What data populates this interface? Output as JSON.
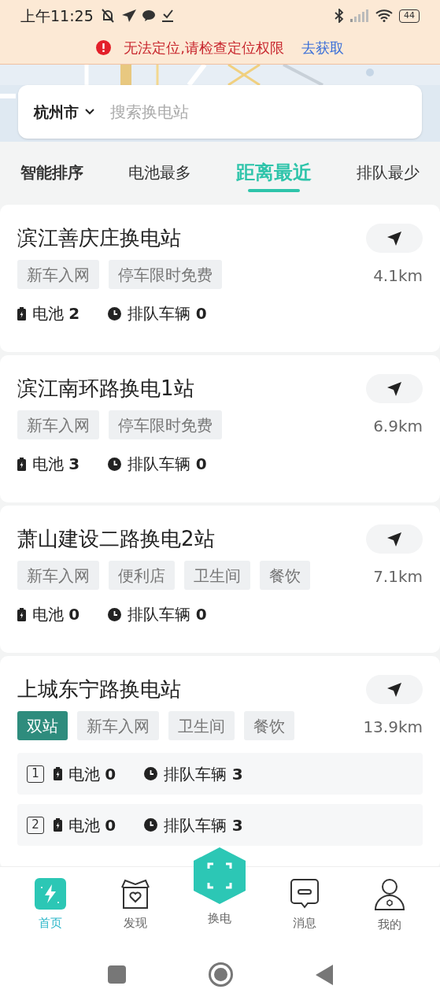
{
  "status_bar": {
    "time": "上午11:25",
    "battery": "44"
  },
  "banner": {
    "message": "无法定位,请检查定位权限",
    "action": "去获取"
  },
  "search": {
    "city": "杭州市",
    "placeholder": "搜索换电站"
  },
  "sort_tabs": [
    {
      "label": "智能排序",
      "selected": false
    },
    {
      "label": "电池最多",
      "selected": false
    },
    {
      "label": "距离最近",
      "selected": true
    },
    {
      "label": "排队最少",
      "selected": false
    }
  ],
  "stations": [
    {
      "name": "滨江善庆庄换电站",
      "distance": "4.1km",
      "kind": "single",
      "tags": [
        {
          "label": "新车入网",
          "kind": "plain"
        },
        {
          "label": "停车限时免费",
          "kind": "plain"
        }
      ],
      "bays": [
        {
          "battery_label": "电池",
          "battery": "2",
          "queue_label": "排队车辆",
          "queue": "0"
        }
      ]
    },
    {
      "name": "滨江南环路换电1站",
      "distance": "6.9km",
      "kind": "single",
      "tags": [
        {
          "label": "新车入网",
          "kind": "plain"
        },
        {
          "label": "停车限时免费",
          "kind": "plain"
        }
      ],
      "bays": [
        {
          "battery_label": "电池",
          "battery": "3",
          "queue_label": "排队车辆",
          "queue": "0"
        }
      ]
    },
    {
      "name": "萧山建设二路换电2站",
      "distance": "7.1km",
      "kind": "single",
      "tags": [
        {
          "label": "新车入网",
          "kind": "plain"
        },
        {
          "label": "便利店",
          "kind": "plain"
        },
        {
          "label": "卫生间",
          "kind": "plain"
        },
        {
          "label": "餐饮",
          "kind": "plain"
        }
      ],
      "bays": [
        {
          "battery_label": "电池",
          "battery": "0",
          "queue_label": "排队车辆",
          "queue": "0"
        }
      ]
    },
    {
      "name": "上城东宁路换电站",
      "distance": "13.9km",
      "kind": "multi",
      "tags": [
        {
          "label": "双站",
          "kind": "highlight"
        },
        {
          "label": "新车入网",
          "kind": "plain"
        },
        {
          "label": "卫生间",
          "kind": "plain"
        },
        {
          "label": "餐饮",
          "kind": "plain"
        }
      ],
      "bays": [
        {
          "number": "1",
          "battery_label": "电池",
          "battery": "0",
          "queue_label": "排队车辆",
          "queue": "3"
        },
        {
          "number": "2",
          "battery_label": "电池",
          "battery": "0",
          "queue_label": "排队车辆",
          "queue": "3"
        }
      ]
    }
  ],
  "bottom_nav": [
    {
      "label": "首页",
      "kind": "home",
      "selected": true
    },
    {
      "label": "发现",
      "kind": "discover",
      "selected": false
    },
    {
      "label": "换电",
      "kind": "swap",
      "selected": false
    },
    {
      "label": "消息",
      "kind": "message",
      "selected": false
    },
    {
      "label": "我的",
      "kind": "profile",
      "selected": false
    }
  ]
}
